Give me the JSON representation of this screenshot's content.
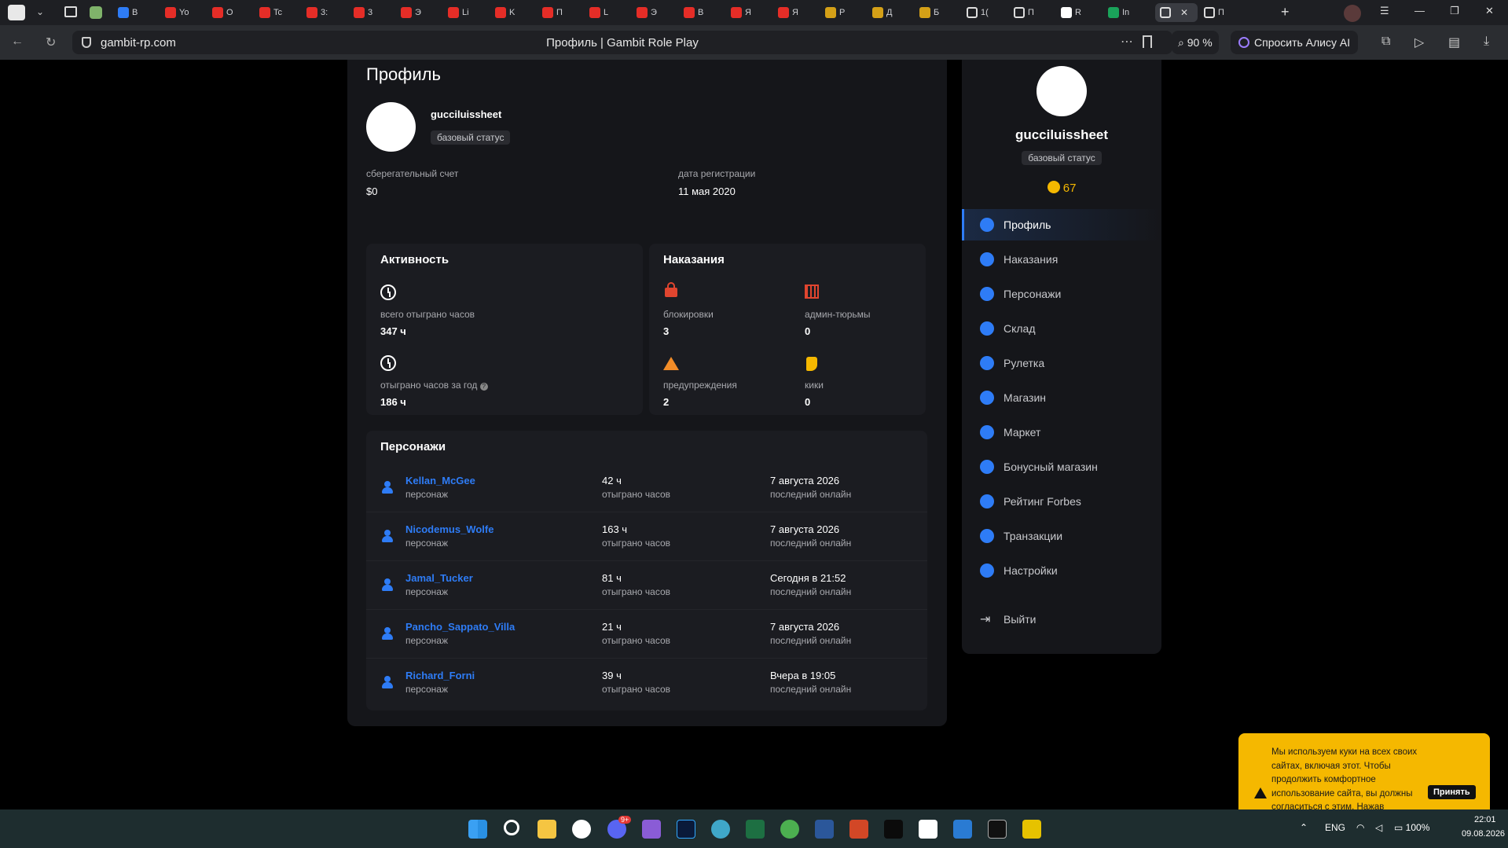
{
  "browser": {
    "tabs": [
      {
        "label": "B",
        "favicon": "speech-bubble-icon"
      },
      {
        "label": "Yo",
        "favicon": "youtube-icon"
      },
      {
        "label": "O",
        "favicon": "youtube-icon"
      },
      {
        "label": "Tc",
        "favicon": "youtube-icon"
      },
      {
        "label": "3:",
        "favicon": "youtube-icon"
      },
      {
        "label": "3",
        "favicon": "youtube-icon"
      },
      {
        "label": "Э",
        "favicon": "youtube-icon"
      },
      {
        "label": "Li",
        "favicon": "youtube-icon"
      },
      {
        "label": "K",
        "favicon": "youtube-icon"
      },
      {
        "label": "П",
        "favicon": "youtube-icon"
      },
      {
        "label": "L",
        "favicon": "youtube-icon"
      },
      {
        "label": "Э",
        "favicon": "youtube-icon"
      },
      {
        "label": "B",
        "favicon": "youtube-icon"
      },
      {
        "label": "Я",
        "favicon": "youtube-icon"
      },
      {
        "label": "Я",
        "favicon": "youtube-icon"
      },
      {
        "label": "P",
        "favicon": "gold-icon"
      },
      {
        "label": "Д",
        "favicon": "gold-icon"
      },
      {
        "label": "Б",
        "favicon": "gold-icon"
      },
      {
        "label": "1(",
        "favicon": "gambit-icon"
      },
      {
        "label": "П",
        "favicon": "gambit-icon"
      },
      {
        "label": "R",
        "favicon": "github-icon"
      },
      {
        "label": "In",
        "favicon": "table-icon"
      },
      {
        "label": "",
        "favicon": "gambit-icon",
        "active": true
      },
      {
        "label": "П",
        "favicon": "gambit-icon"
      }
    ],
    "url": "gambit-rp.com",
    "page_title": "Профиль | Gambit Role Play",
    "zoom": "90 %",
    "alice_label": "Спросить Алису AI"
  },
  "profile": {
    "heading": "Профиль",
    "username": "gucciluissheet",
    "status_badge": "базовый статус",
    "savings_label": "сберегательный счет",
    "savings_value": "$0",
    "reg_label": "дата регистрации",
    "reg_value": "11 мая 2020"
  },
  "activity": {
    "title": "Активность",
    "total_label": "всего отыграно часов",
    "total_value": "347 ч",
    "year_label": "отыграно часов за год",
    "year_value": "186 ч"
  },
  "punishments": {
    "title": "Наказания",
    "bans_label": "блокировки",
    "bans_value": "3",
    "jail_label": "админ-тюрьмы",
    "jail_value": "0",
    "warns_label": "предупреждения",
    "warns_value": "2",
    "kicks_label": "кики",
    "kicks_value": "0"
  },
  "characters": {
    "title": "Персонажи",
    "rows": [
      {
        "name": "Kellan_McGee",
        "sub": "персонаж",
        "hours": "42 ч",
        "hours_label": "отыграно часов",
        "last": "7 августа 2026",
        "last_label": "последний онлайн"
      },
      {
        "name": "Nicodemus_Wolfe",
        "sub": "персонаж",
        "hours": "163 ч",
        "hours_label": "отыграно часов",
        "last": "7 августа 2026",
        "last_label": "последний онлайн"
      },
      {
        "name": "Jamal_Tucker",
        "sub": "персонаж",
        "hours": "81 ч",
        "hours_label": "отыграно часов",
        "last": "Сегодня в 21:52",
        "last_label": "последний онлайн"
      },
      {
        "name": "Pancho_Sappato_Villa",
        "sub": "персонаж",
        "hours": "21 ч",
        "hours_label": "отыграно часов",
        "last": "7 августа 2026",
        "last_label": "последний онлайн"
      },
      {
        "name": "Richard_Forni",
        "sub": "персонаж",
        "hours": "39 ч",
        "hours_label": "отыграно часов",
        "last": "Вчера в 19:05",
        "last_label": "последний онлайн"
      }
    ]
  },
  "sidebar": {
    "username": "gucciluissheet",
    "status_badge": "базовый статус",
    "coins": "67",
    "items": [
      {
        "label": "Профиль",
        "icon": "user-circle-icon",
        "active": true
      },
      {
        "label": "Наказания",
        "icon": "alert-circle-icon"
      },
      {
        "label": "Персонажи",
        "icon": "person-icon"
      },
      {
        "label": "Склад",
        "icon": "warehouse-icon"
      },
      {
        "label": "Рулетка",
        "icon": "roulette-icon"
      },
      {
        "label": "Магазин",
        "icon": "shop-icon"
      },
      {
        "label": "Маркет",
        "icon": "market-bag-icon"
      },
      {
        "label": "Бонусный магазин",
        "icon": "bonus-coin-icon"
      },
      {
        "label": "Рейтинг Forbes",
        "icon": "trophy-icon"
      },
      {
        "label": "Транзакции",
        "icon": "transactions-icon"
      },
      {
        "label": "Настройки",
        "icon": "gear-icon"
      }
    ],
    "logout": "Выйти"
  },
  "cookie": {
    "text": "Мы используем куки на всех своих сайтах, включая этот. Чтобы продолжить комфортное использование сайта, вы должны согласиться с этим. Нажав «Принять», вы соглашаетесь на эти действия",
    "accept": "Принять"
  },
  "taskbar": {
    "lang": "ENG",
    "battery": "100%",
    "time": "22:01",
    "date": "09.08.2026",
    "discord_badge": "9+"
  },
  "colors": {
    "accent": "#2e7cf6",
    "cookie_bg": "#f5b800",
    "ban_red": "#e0452f",
    "warn_orange": "#f28c28",
    "kick_yellow": "#f5b800"
  }
}
